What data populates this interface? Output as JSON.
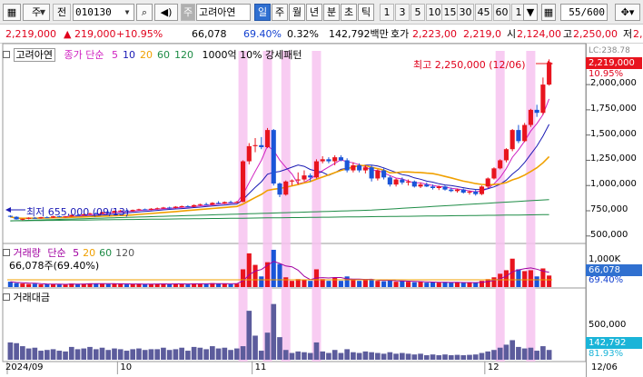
{
  "toolbar": {
    "market_label": "주",
    "type_label": "전",
    "code_value": "010130",
    "stock_prefix": "주",
    "stock_name": "고려아연",
    "tabs": [
      "일",
      "주",
      "월",
      "년",
      "분",
      "초",
      "틱"
    ],
    "active_tab": "일",
    "periods": [
      "1",
      "3",
      "5",
      "10",
      "15",
      "30",
      "45",
      "60",
      "1"
    ],
    "count_value": "55",
    "count_total": "/600"
  },
  "info": {
    "price": "2,219,000",
    "change": "▲ 219,000",
    "change_rate": "+10.95%",
    "volume": "66,078",
    "volume_ratio": "69.40%",
    "turnover": "0.32%",
    "amount": "142,792백만",
    "quote_label": "호가",
    "quote_ask": "2,223,00",
    "quote_bid": "2,219,0",
    "open_label": "시",
    "open_value": "2,124,00",
    "high_label": "고",
    "high_value": "2,250,00",
    "low_label": "저",
    "low_value": "2,0"
  },
  "price_panel": {
    "stock_name": "고려아연",
    "ma_label": "종가 단순",
    "ma_periods": [
      "5",
      "10",
      "20",
      "60",
      "120"
    ],
    "ma_colors": [
      "#d020c0",
      "#1a1ab4",
      "#f0a000",
      "#1e8c46",
      "#1e8c46"
    ],
    "indicator_label": "1000억 10% 강세패턴",
    "high_annotation": "최고 2,250,000 (12/06)",
    "low_annotation": "최저 655,000 (09/13)",
    "lc_label": "LC:238.78",
    "current_price_tag": "2,219,000",
    "rate_tag": "10.95%"
  },
  "volume_panel": {
    "label": "거래량",
    "ma_label": "단순",
    "ma_periods": [
      "5",
      "20",
      "60",
      "120"
    ],
    "value_label": "66,078주(69.40%)",
    "current_tag": "66,078",
    "ratio_tag": "69.40%"
  },
  "amount_panel": {
    "label": "거래대금",
    "current_tag": "142,792",
    "ratio_tag": "81.93%"
  },
  "axis": {
    "price_ticks": [
      "2,000,000",
      "1,750,000",
      "1,500,000",
      "1,250,000",
      "1,000,000",
      "750,000",
      "500,000"
    ],
    "volume_ticks": [
      "1,000K"
    ],
    "amount_ticks": [
      "500,000"
    ],
    "date_labels": [
      "2024/09",
      "10",
      "11",
      "12",
      "12/06"
    ]
  },
  "colors": {
    "up": "#e8141e",
    "down": "#1a55d8",
    "highlight": "#f7c3f0",
    "bar": "#5c5c9c"
  },
  "chart_data": {
    "type": "candlestick",
    "y_range": [
      480000,
      2280000
    ],
    "highlighted_days": [
      38,
      42,
      45,
      50,
      80,
      85
    ],
    "candles": [
      [
        700000,
        705000,
        685000,
        690000
      ],
      [
        690000,
        695000,
        662000,
        665000
      ],
      [
        665000,
        672000,
        655000,
        670000
      ],
      [
        670000,
        685000,
        665000,
        680000
      ],
      [
        680000,
        688000,
        672000,
        676000
      ],
      [
        676000,
        690000,
        672000,
        686000
      ],
      [
        686000,
        694000,
        678000,
        682000
      ],
      [
        682000,
        700000,
        678000,
        695000
      ],
      [
        695000,
        702000,
        685000,
        690000
      ],
      [
        690000,
        698000,
        682000,
        694000
      ],
      [
        694000,
        712000,
        690000,
        708000
      ],
      [
        708000,
        715000,
        700000,
        704000
      ],
      [
        704000,
        720000,
        700000,
        716000
      ],
      [
        716000,
        730000,
        712000,
        725000
      ],
      [
        725000,
        735000,
        715000,
        720000
      ],
      [
        720000,
        740000,
        716000,
        735000
      ],
      [
        735000,
        742000,
        725000,
        730000
      ],
      [
        730000,
        752000,
        726000,
        748000
      ],
      [
        748000,
        758000,
        740000,
        752000
      ],
      [
        752000,
        760000,
        742000,
        746000
      ],
      [
        746000,
        762000,
        742000,
        758000
      ],
      [
        758000,
        770000,
        752000,
        765000
      ],
      [
        765000,
        772000,
        755000,
        760000
      ],
      [
        760000,
        776000,
        756000,
        770000
      ],
      [
        770000,
        782000,
        762000,
        775000
      ],
      [
        775000,
        788000,
        770000,
        782000
      ],
      [
        782000,
        790000,
        770000,
        778000
      ],
      [
        778000,
        796000,
        774000,
        790000
      ],
      [
        790000,
        802000,
        782000,
        795000
      ],
      [
        795000,
        805000,
        785000,
        790000
      ],
      [
        790000,
        812000,
        786000,
        806000
      ],
      [
        806000,
        820000,
        800000,
        815000
      ],
      [
        815000,
        830000,
        805000,
        810000
      ],
      [
        810000,
        835000,
        806000,
        828000
      ],
      [
        828000,
        845000,
        818000,
        822000
      ],
      [
        822000,
        842000,
        816000,
        836000
      ],
      [
        836000,
        850000,
        825000,
        830000
      ],
      [
        830000,
        845000,
        826000,
        838000
      ],
      [
        838000,
        1250000,
        835000,
        1240000
      ],
      [
        1240000,
        1420000,
        1210000,
        1390000
      ],
      [
        1390000,
        1470000,
        1330000,
        1400000
      ],
      [
        1400000,
        1480000,
        1360000,
        1380000
      ],
      [
        1380000,
        1570000,
        1370000,
        1550000
      ],
      [
        1550000,
        1560000,
        1000000,
        1020000
      ],
      [
        1020000,
        1030000,
        885000,
        910000
      ],
      [
        910000,
        1050000,
        900000,
        1040000
      ],
      [
        1040000,
        1060000,
        1000000,
        1050000
      ],
      [
        1050000,
        1130000,
        1010000,
        1060000
      ],
      [
        1060000,
        1150000,
        1040000,
        1100000
      ],
      [
        1100000,
        1120000,
        1040000,
        1080000
      ],
      [
        1080000,
        1260000,
        1070000,
        1240000
      ],
      [
        1240000,
        1290000,
        1220000,
        1260000
      ],
      [
        1260000,
        1280000,
        1220000,
        1240000
      ],
      [
        1240000,
        1300000,
        1200000,
        1280000
      ],
      [
        1280000,
        1300000,
        1240000,
        1250000
      ],
      [
        1250000,
        1270000,
        1130000,
        1150000
      ],
      [
        1150000,
        1230000,
        1130000,
        1200000
      ],
      [
        1200000,
        1220000,
        1130000,
        1150000
      ],
      [
        1150000,
        1200000,
        1120000,
        1180000
      ],
      [
        1180000,
        1200000,
        1040000,
        1070000
      ],
      [
        1070000,
        1160000,
        1050000,
        1150000
      ],
      [
        1150000,
        1170000,
        1060000,
        1080000
      ],
      [
        1080000,
        1100000,
        990000,
        1010000
      ],
      [
        1010000,
        1070000,
        990000,
        1060000
      ],
      [
        1060000,
        1080000,
        1010000,
        1030000
      ],
      [
        1030000,
        1060000,
        1000000,
        1040000
      ],
      [
        1040000,
        1050000,
        980000,
        990000
      ],
      [
        990000,
        1030000,
        975000,
        1010000
      ],
      [
        1010000,
        1030000,
        985000,
        990000
      ],
      [
        990000,
        1010000,
        960000,
        975000
      ],
      [
        975000,
        1000000,
        955000,
        990000
      ],
      [
        990000,
        1000000,
        950000,
        960000
      ],
      [
        960000,
        980000,
        935000,
        945000
      ],
      [
        945000,
        970000,
        930000,
        960000
      ],
      [
        960000,
        970000,
        920000,
        930000
      ],
      [
        930000,
        950000,
        910000,
        940000
      ],
      [
        940000,
        960000,
        900000,
        915000
      ],
      [
        915000,
        1000000,
        905000,
        990000
      ],
      [
        990000,
        1080000,
        975000,
        1070000
      ],
      [
        1070000,
        1180000,
        1060000,
        1170000
      ],
      [
        1170000,
        1260000,
        1160000,
        1250000
      ],
      [
        1250000,
        1370000,
        1230000,
        1360000
      ],
      [
        1360000,
        1560000,
        1340000,
        1550000
      ],
      [
        1550000,
        1600000,
        1420000,
        1440000
      ],
      [
        1440000,
        1620000,
        1430000,
        1600000
      ],
      [
        1600000,
        1760000,
        1580000,
        1750000
      ],
      [
        1750000,
        1800000,
        1680000,
        1720000
      ],
      [
        1720000,
        2070000,
        1700000,
        2000000
      ],
      [
        2000000,
        2250000,
        1990000,
        2219000
      ]
    ],
    "ma5": [],
    "volume": [
      60,
      45,
      40,
      35,
      38,
      30,
      32,
      35,
      30,
      28,
      40,
      35,
      38,
      42,
      36,
      40,
      34,
      38,
      36,
      30,
      34,
      38,
      32,
      36,
      34,
      40,
      32,
      36,
      38,
      30,
      42,
      40,
      34,
      44,
      36,
      40,
      32,
      38,
      200,
      380,
      250,
      120,
      280,
      420,
      260,
      110,
      70,
      90,
      80,
      70,
      200,
      90,
      70,
      110,
      70,
      120,
      80,
      70,
      90,
      80,
      70,
      65,
      80,
      60,
      70,
      60,
      55,
      60,
      50,
      55,
      50,
      58,
      50,
      52,
      48,
      50,
      52,
      70,
      90,
      110,
      150,
      190,
      320,
      200,
      180,
      190,
      120,
      210,
      130
    ],
    "amount": [
      230,
      220,
      180,
      150,
      160,
      120,
      130,
      140,
      120,
      110,
      170,
      140,
      150,
      170,
      140,
      160,
      130,
      150,
      140,
      120,
      140,
      150,
      130,
      140,
      140,
      160,
      130,
      140,
      160,
      120,
      170,
      160,
      140,
      180,
      150,
      160,
      130,
      150,
      180,
      650,
      320,
      120,
      360,
      740,
      300,
      130,
      90,
      110,
      100,
      90,
      230,
      110,
      90,
      130,
      90,
      140,
      100,
      90,
      110,
      100,
      90,
      80,
      100,
      80,
      90,
      80,
      70,
      80,
      60,
      70,
      60,
      70,
      60,
      65,
      60,
      65,
      70,
      90,
      110,
      130,
      160,
      200,
      260,
      170,
      150,
      160,
      120,
      180,
      130
    ]
  }
}
